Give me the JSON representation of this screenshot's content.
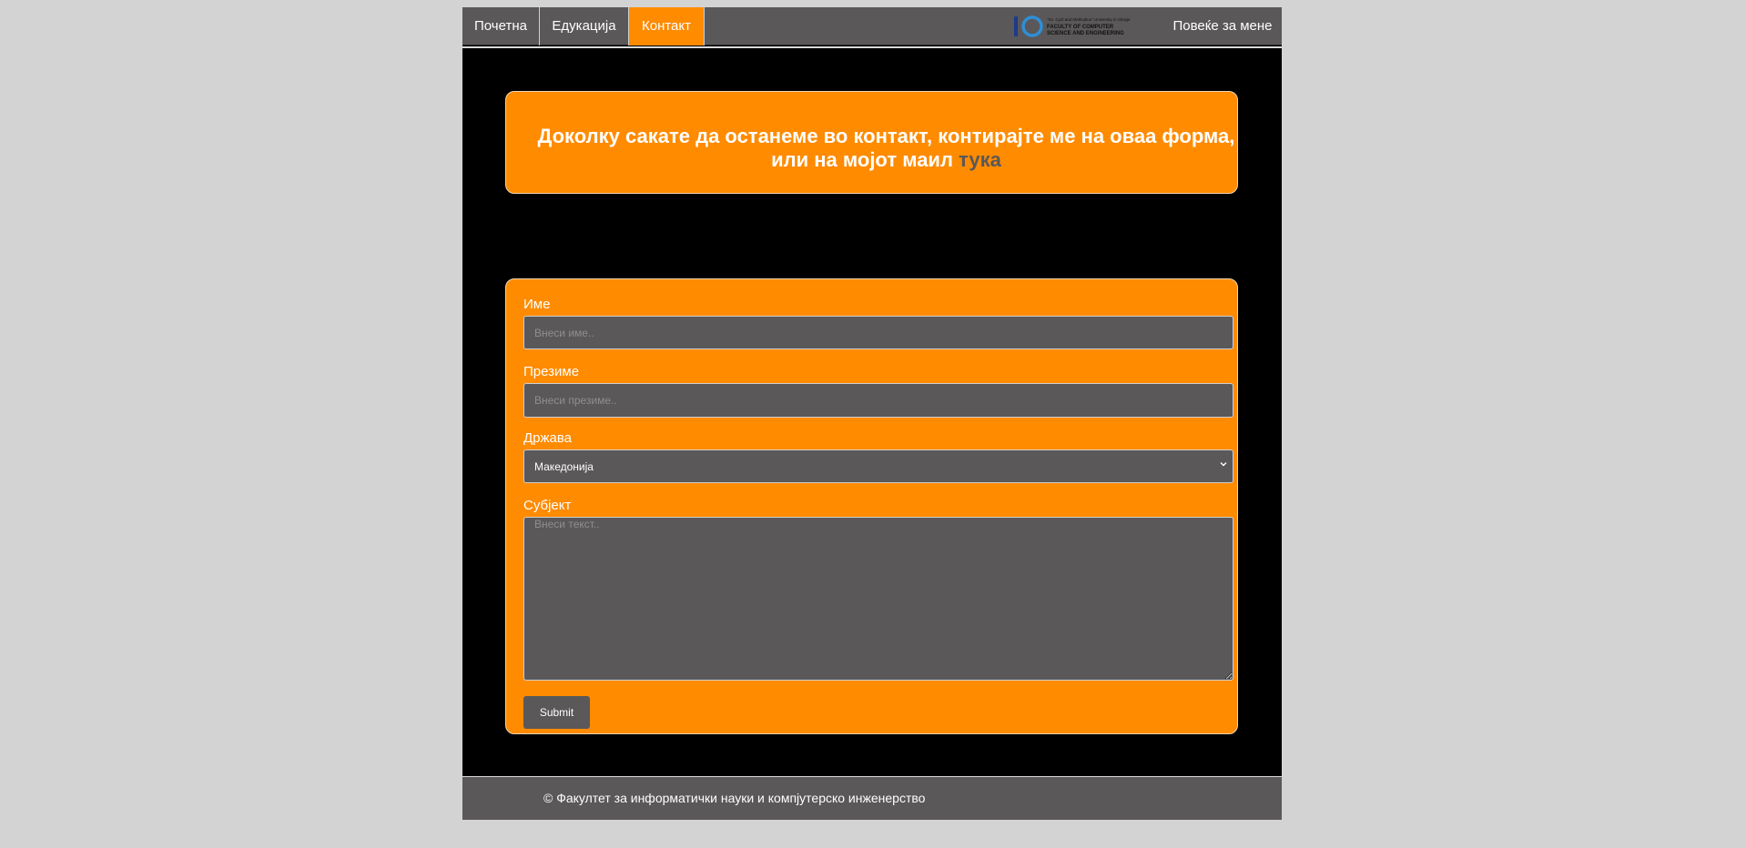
{
  "nav": {
    "items": [
      {
        "label": "Почетна"
      },
      {
        "label": "Едукација"
      },
      {
        "label": "Контакт",
        "active": true
      }
    ],
    "about_label": "Повеќе за мене",
    "logo": {
      "icon": "finki-logo",
      "line1": "\"Ss. Cyril and Methodius\" University in Skopje",
      "line2": "FACULTY OF COMPUTER",
      "line3": "SCIENCE AND ENGINEERING"
    }
  },
  "banner": {
    "text_before": "Доколку сакате да останеме во контакт, контирајте ме на оваа форма, или на мојот маил ",
    "link_text": "тука"
  },
  "form": {
    "first_name_label": "Име",
    "first_name_placeholder": "Внеси име..",
    "first_name_value": "",
    "last_name_label": "Презиме",
    "last_name_placeholder": "Внеси презиме..",
    "last_name_value": "",
    "country_label": "Држава",
    "country_selected": "Македонија",
    "subject_label": "Субјект",
    "subject_placeholder": "Внеси текст..",
    "subject_value": "",
    "submit_label": "Submit"
  },
  "footer": {
    "text": "© Факултет за информатички науки и компјутерско инженерство"
  },
  "colors": {
    "page_bg": "#d3d3d3",
    "content_bg": "#000000",
    "accent": "#ff8b00",
    "nav_bg": "#5a5859",
    "field_bg": "#5a5859",
    "text": "#ffffff"
  }
}
